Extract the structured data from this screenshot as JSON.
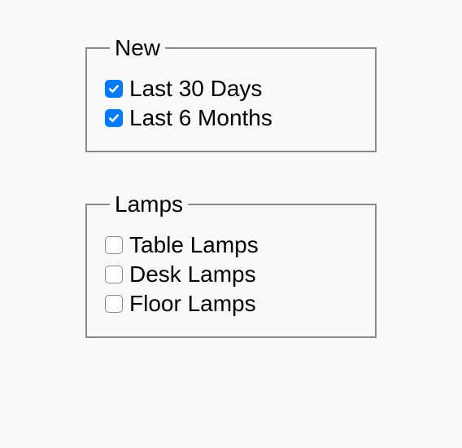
{
  "groups": {
    "new": {
      "legend": "New",
      "options": [
        {
          "label": "Last 30 Days",
          "checked": true
        },
        {
          "label": "Last 6 Months",
          "checked": true
        }
      ]
    },
    "lamps": {
      "legend": "Lamps",
      "options": [
        {
          "label": "Table Lamps",
          "checked": false
        },
        {
          "label": "Desk Lamps",
          "checked": false
        },
        {
          "label": "Floor Lamps",
          "checked": false
        }
      ]
    }
  }
}
